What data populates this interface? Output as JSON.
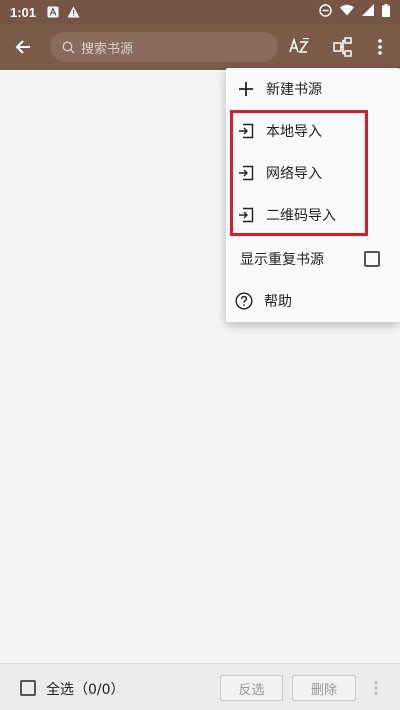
{
  "status_bar": {
    "time": "1:01",
    "icons": [
      "a-badge-icon",
      "warning-icon",
      "do-not-disturb-icon",
      "wifi-icon",
      "signal-icon",
      "battery-icon"
    ]
  },
  "toolbar": {
    "back_icon": "arrow-back-icon",
    "search_placeholder": "搜索书源",
    "sort_icon": "sort-az-icon",
    "group_icon": "group-icon",
    "more_icon": "more-vert-icon"
  },
  "menu": {
    "new_source": "新建书源",
    "local_import": "本地导入",
    "network_import": "网络导入",
    "qrcode_import": "二维码导入",
    "show_duplicates": "显示重复书源",
    "help": "帮助"
  },
  "bottom_bar": {
    "select_all": "全选（0/0）",
    "invert": "反选",
    "delete": "删除"
  },
  "colors": {
    "toolbar": "#7b5b4a",
    "highlight": "#e0192b"
  }
}
